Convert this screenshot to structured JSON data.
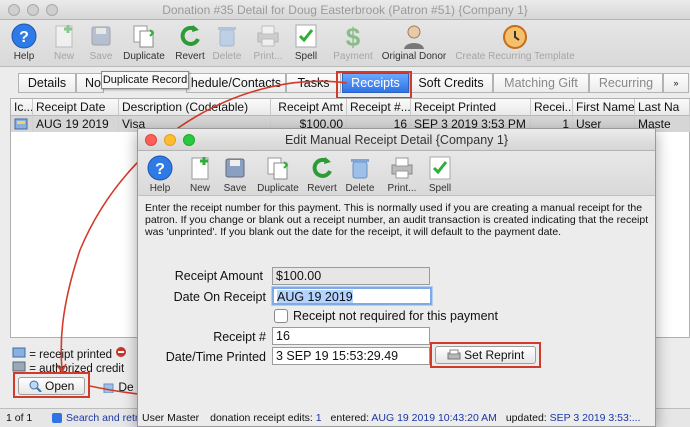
{
  "main": {
    "title": "Donation #35 Detail for Doug Easterbrook (Patron #51) {Company 1}",
    "toolbar": [
      {
        "label": "Help",
        "icon": "help-icon",
        "enabled": true
      },
      {
        "label": "New",
        "icon": "new-icon",
        "enabled": false
      },
      {
        "label": "Save",
        "icon": "save-icon",
        "enabled": false
      },
      {
        "label": "Duplicate",
        "icon": "duplicate-icon",
        "enabled": true
      },
      {
        "label": "Revert",
        "icon": "revert-icon",
        "enabled": true
      },
      {
        "label": "Delete",
        "icon": "delete-icon",
        "enabled": false
      },
      {
        "label": "Print...",
        "icon": "print-icon",
        "enabled": false
      },
      {
        "label": "Spell",
        "icon": "spell-icon",
        "enabled": true
      },
      {
        "label": "Payment",
        "icon": "payment-icon",
        "enabled": false
      },
      {
        "label": "Original Donor",
        "icon": "original-donor-icon",
        "enabled": true
      },
      {
        "label": "Create Recurring Template",
        "icon": "clock-icon",
        "enabled": false
      }
    ],
    "tabs": [
      {
        "label": "Details"
      },
      {
        "label": "No"
      },
      {
        "label": "hedule/Contacts"
      },
      {
        "label": "Tasks"
      },
      {
        "label": "Receipts"
      },
      {
        "label": "Soft Credits"
      },
      {
        "label": "Matching Gift"
      },
      {
        "label": "Recurring"
      }
    ],
    "tooltip": "Duplicate Record",
    "grid": {
      "columns": [
        "Ic...",
        "Receipt Date",
        "Description (Codetable)",
        "Receipt Amt",
        "Receipt #...",
        "Receipt Printed",
        "Recei...",
        "First Name",
        "Last Na"
      ],
      "rows": [
        [
          "",
          "AUG 19 2019",
          "Visa",
          "$100.00",
          "16",
          "SEP 3 2019 3:53 PM",
          "1",
          "User",
          "Maste"
        ]
      ]
    },
    "legend": {
      "printed": "= receipt printed",
      "authorized": "= authorized credit"
    },
    "open_label": "Open",
    "de_label": "De",
    "status": {
      "count": "1 of 1",
      "search_text": "Search and retri"
    }
  },
  "dialog": {
    "title": "Edit Manual Receipt Detail {Company 1}",
    "toolbar": [
      {
        "label": "Help",
        "icon": "help-icon",
        "enabled": true
      },
      {
        "label": "New",
        "icon": "new-icon",
        "enabled": true
      },
      {
        "label": "Save",
        "icon": "save-icon",
        "enabled": true
      },
      {
        "label": "Duplicate",
        "icon": "duplicate-icon",
        "enabled": true
      },
      {
        "label": "Revert",
        "icon": "revert-icon",
        "enabled": true
      },
      {
        "label": "Delete",
        "icon": "delete-icon",
        "enabled": true
      },
      {
        "label": "Print...",
        "icon": "print-icon",
        "enabled": true
      },
      {
        "label": "Spell",
        "icon": "spell-icon",
        "enabled": true
      }
    ],
    "description": "Enter the receipt number for this payment.  This is normally used if you are creating a manual receipt for the patron.  If you change or blank out a receipt number, an audit transaction is created indicating that the receipt was 'unprinted'.  If you blank out the date for the receipt, it will default to the payment date.",
    "fields": {
      "receipt_amount_label": "Receipt Amount",
      "receipt_amount": "$100.00",
      "date_on_receipt_label": "Date On Receipt",
      "date_on_receipt": "AUG 19 2019",
      "not_required_label": "Receipt not required for this payment",
      "receipt_no_label": "Receipt #",
      "receipt_no": "16",
      "printed_label": "Date/Time Printed",
      "printed": "3 SEP 19  15:53:29.49",
      "set_reprint_label": "Set Reprint"
    },
    "status": {
      "user": "User Master",
      "edits_label": "donation receipt edits:",
      "edits": "1",
      "entered_label": "entered:",
      "entered": "AUG 19 2019 10:43:20 AM",
      "updated_label": "updated:",
      "updated": "SEP 3 2019 3:53:..."
    }
  },
  "colors": {
    "annotation_red": "#d23b2b",
    "tab_selected": "#3a7ff0",
    "link_blue": "#1a37a6"
  }
}
